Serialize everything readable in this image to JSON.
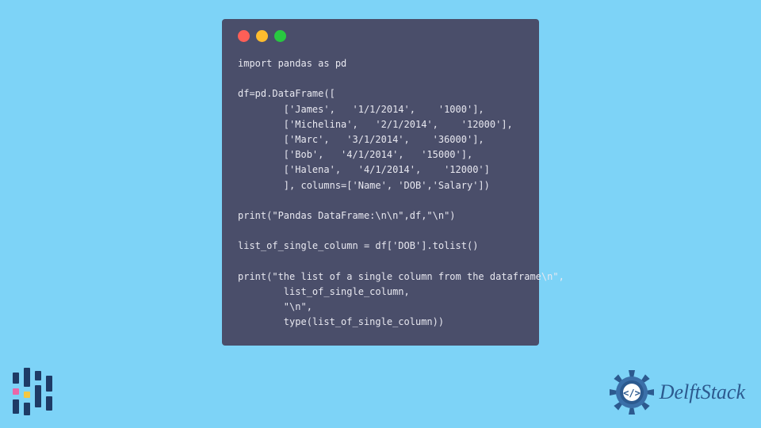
{
  "code": {
    "lines": [
      "import pandas as pd",
      "",
      "df=pd.DataFrame([",
      "        ['James',   '1/1/2014',    '1000'],",
      "        ['Michelina',   '2/1/2014',    '12000'],",
      "        ['Marc',   '3/1/2014',    '36000'],",
      "        ['Bob',   '4/1/2014',   '15000'],",
      "        ['Halena',   '4/1/2014',    '12000']",
      "        ], columns=['Name', 'DOB','Salary'])",
      "",
      "print(\"Pandas DataFrame:\\n\\n\",df,\"\\n\")",
      "",
      "list_of_single_column = df['DOB'].tolist()",
      "",
      "print(\"the list of a single column from the dataframe\\n\",",
      "        list_of_single_column,",
      "        \"\\n\",",
      "        type(list_of_single_column))"
    ]
  },
  "brand": {
    "name": "DelftStack"
  },
  "colors": {
    "bg": "#7dd3f7",
    "window": "#4a4e6a",
    "text": "#e8e8f0",
    "brandBlue": "#2c5a8f",
    "brandNavy": "#1e3b66",
    "pink": "#e968a8",
    "yellow": "#f5c842"
  }
}
